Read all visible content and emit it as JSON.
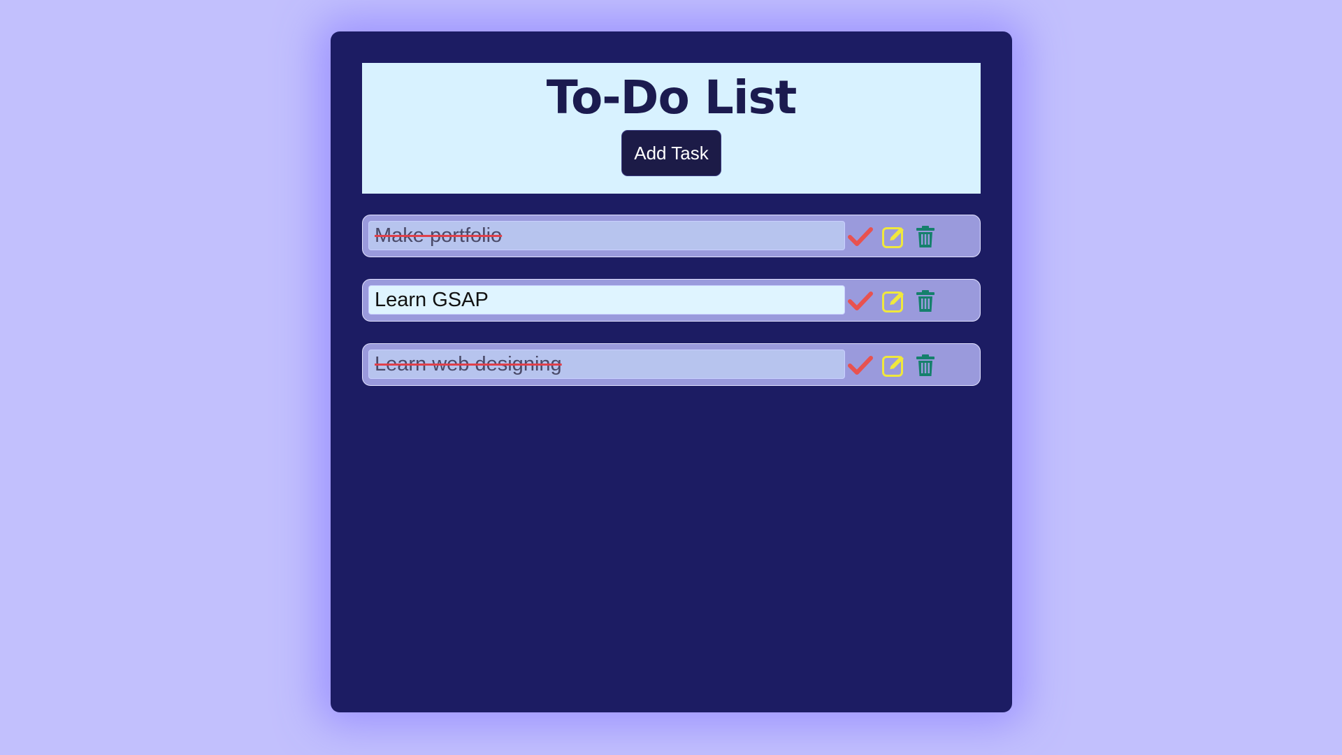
{
  "header": {
    "title": "To-Do List",
    "add_button_label": "Add Task"
  },
  "tasks": [
    {
      "text": "Make portfolio",
      "completed": true
    },
    {
      "text": "Learn GSAP",
      "completed": false
    },
    {
      "text": "Learn web designing",
      "completed": true
    }
  ],
  "task_actions": {
    "complete_icon": "check-icon",
    "edit_icon": "edit-icon",
    "delete_icon": "trash-icon"
  },
  "colors": {
    "page_background": "#c2c0fd",
    "card_background": "#1c1c63",
    "header_background": "#d8f2ff",
    "button_background": "#1c1b47",
    "check": "#e8524f",
    "edit": "#f0e83c",
    "trash": "#15806c",
    "strikethrough": "#e0404a"
  }
}
